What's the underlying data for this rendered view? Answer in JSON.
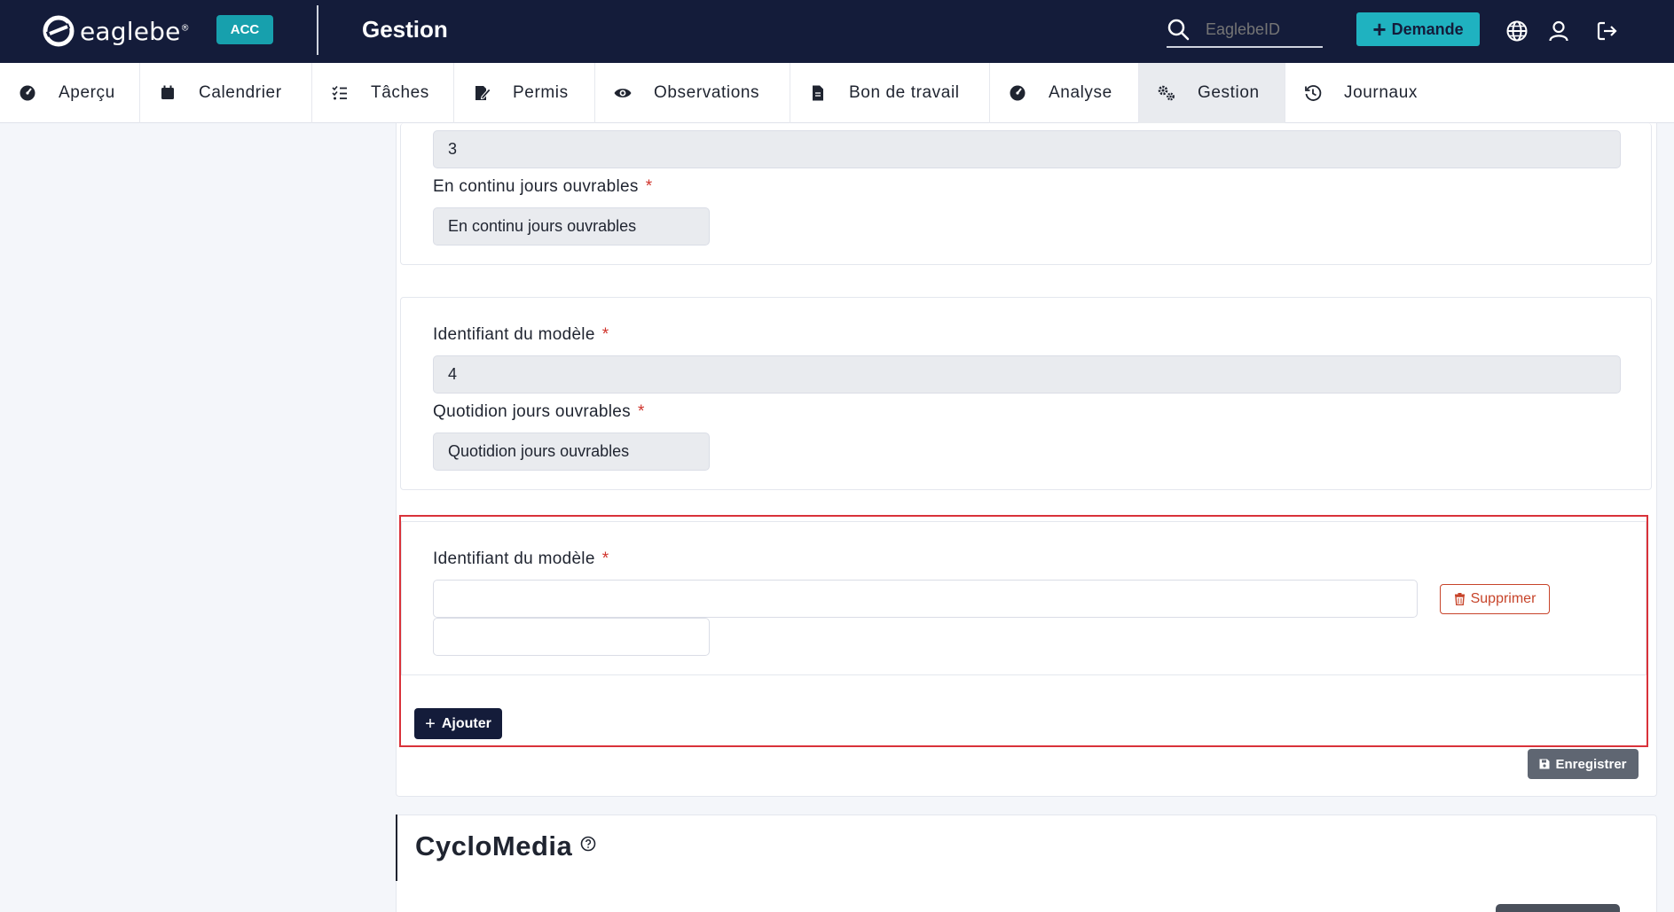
{
  "header": {
    "logo_text": "eaglebe",
    "logo_reg": "®",
    "env_badge": "ACC",
    "title": "Gestion",
    "search_placeholder": "EaglebeID",
    "demande_label": "Demande",
    "icons": [
      "globe-icon",
      "user-icon",
      "logout-icon"
    ]
  },
  "nav": {
    "tabs": [
      {
        "label": "Aperçu",
        "icon": "dashboard-icon"
      },
      {
        "label": "Calendrier",
        "icon": "calendar-icon"
      },
      {
        "label": "Tâches",
        "icon": "tasks-icon"
      },
      {
        "label": "Permis",
        "icon": "permit-icon"
      },
      {
        "label": "Observations",
        "icon": "eye-icon"
      },
      {
        "label": "Bon de travail",
        "icon": "document-icon"
      },
      {
        "label": "Analyse",
        "icon": "analysis-icon"
      },
      {
        "label": "Gestion",
        "icon": "gears-icon",
        "active": true
      },
      {
        "label": "Journaux",
        "icon": "history-icon"
      }
    ]
  },
  "form": {
    "item3": {
      "id_value": "3",
      "name_label": "En continu jours ouvrables",
      "name_value": "En continu jours ouvrables"
    },
    "item4": {
      "id_label": "Identifiant du modèle",
      "id_value": "4",
      "name_label": "Quotidion jours ouvrables",
      "name_value": "Quotidion jours ouvrables"
    },
    "new_item": {
      "id_label": "Identifiant du modèle",
      "id_value": "",
      "name_value": ""
    },
    "required_mark": "*",
    "delete_label": "Supprimer",
    "add_label": "Ajouter",
    "save_label": "Enregistrer"
  },
  "section": {
    "title": "CycloMedia"
  },
  "colors": {
    "header_bg": "#141c3a",
    "accent": "#1fb2c0",
    "danger": "#c7442a",
    "highlight": "#d9323a"
  }
}
